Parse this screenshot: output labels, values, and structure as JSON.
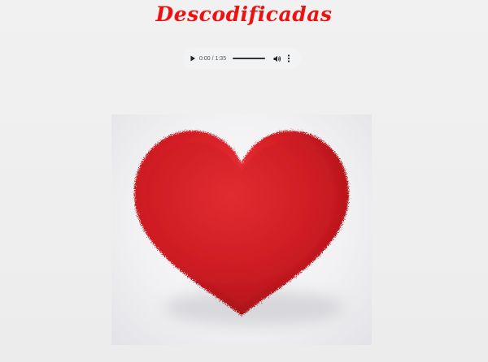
{
  "header": {
    "title": "Descodificadas"
  },
  "audio_player": {
    "time_display": "0:00 / 1:35",
    "progress": 0,
    "play_icon": "play-icon",
    "volume_icon": "volume-icon",
    "menu_icon": "more-vert-icon"
  },
  "main_image": {
    "subject": "red fluffy heart"
  },
  "colors": {
    "title": "#ee1111",
    "heart": "#d81f26",
    "background": "#f0f0f0"
  }
}
